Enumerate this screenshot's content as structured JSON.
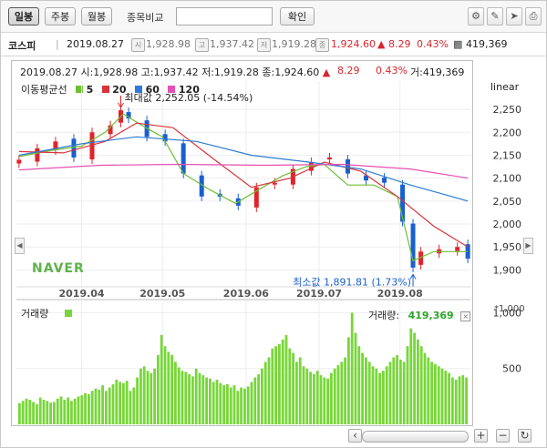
{
  "toolbar": {
    "buttons": [
      "일봉",
      "주봉",
      "월봉"
    ],
    "compare_label": "종목비교",
    "compare_value": "",
    "confirm_label": "확인"
  },
  "info": {
    "index_name": "코스피",
    "date": "2019.08.27",
    "open_tag": "시",
    "open": "1,928.98",
    "high_tag": "고",
    "high": "1,937.42",
    "low_tag": "저",
    "low": "1,919.28",
    "close_tag": "종",
    "close": "1,924.60",
    "change": "▲ 8.29",
    "change_pct": "0.43%",
    "volume": "419,369"
  },
  "chart_header": {
    "line": "2019.08.27 시:1,928.98 고:1,937.42 저:1,919.28 종:1,924.60",
    "arrow": "▲",
    "change": "8.29",
    "pct": "0.43%",
    "volume": "거:419,369"
  },
  "colors": {
    "up": "#e0242b",
    "down": "#1a5fd0",
    "ma5": "#6fbf35",
    "ma20": "#d9343a",
    "ma60": "#2f7ad4",
    "ma120": "#e64fb2",
    "volume": "#78d63a",
    "naver": "#5db34a"
  },
  "chart_data": [
    {
      "type": "line",
      "scale_label": "linear",
      "legend_title": "이동평균선",
      "legend": [
        {
          "label": "5",
          "color": "#6fbf35"
        },
        {
          "label": "20",
          "color": "#d9343a"
        },
        {
          "label": "60",
          "color": "#2f7ad4"
        },
        {
          "label": "120",
          "color": "#e64fb2"
        }
      ],
      "x_ticks": [
        "2019.04",
        "2019.05",
        "2019.06",
        "2019.07",
        "2019.08"
      ],
      "x_tick_dates": [
        "2019-04-01",
        "2019-05-02",
        "2019-06-03",
        "2019-07-01",
        "2019-08-01"
      ],
      "x_range": [
        "2019-03-07",
        "2019-08-28"
      ],
      "y_ticks": [
        1900,
        1950,
        2000,
        2050,
        2100,
        2150,
        2200,
        2250
      ],
      "y_tick_labels": [
        "1,900",
        "1,950",
        "2,000",
        "2,050",
        "2,100",
        "2,150",
        "2,200",
        "2,250"
      ],
      "ylim": [
        1875,
        2272
      ],
      "annotations": {
        "max": {
          "label": "최대값 2,252.05 (-14.54%)",
          "date": "2019-04-16",
          "value": 2252.05
        },
        "min": {
          "label": "최소값 1,891.81 (1.73%)",
          "date": "2019-08-06",
          "value": 1891.81
        }
      },
      "watermark": "NAVER",
      "series": [
        {
          "name": "5",
          "color": "#6fbf35",
          "x": [
            "2019-03-08",
            "2019-03-20",
            "2019-04-01",
            "2019-04-10",
            "2019-04-17",
            "2019-04-25",
            "2019-05-02",
            "2019-05-10",
            "2019-05-20",
            "2019-05-30",
            "2019-06-07",
            "2019-06-17",
            "2019-06-26",
            "2019-07-03",
            "2019-07-12",
            "2019-07-22",
            "2019-07-31",
            "2019-08-06",
            "2019-08-14",
            "2019-08-27"
          ],
          "y": [
            2147,
            2160,
            2170,
            2200,
            2240,
            2212,
            2190,
            2110,
            2075,
            2045,
            2072,
            2105,
            2125,
            2130,
            2085,
            2085,
            2060,
            1920,
            1940,
            1940
          ]
        },
        {
          "name": "20",
          "color": "#d9343a",
          "x": [
            "2019-03-08",
            "2019-03-25",
            "2019-04-10",
            "2019-04-22",
            "2019-05-06",
            "2019-05-22",
            "2019-06-05",
            "2019-06-20",
            "2019-07-03",
            "2019-07-17",
            "2019-07-31",
            "2019-08-14",
            "2019-08-27"
          ],
          "y": [
            2158,
            2155,
            2180,
            2220,
            2210,
            2140,
            2080,
            2100,
            2135,
            2115,
            2060,
            1995,
            1950
          ]
        },
        {
          "name": "60",
          "color": "#2f7ad4",
          "x": [
            "2019-03-08",
            "2019-04-01",
            "2019-04-22",
            "2019-05-15",
            "2019-06-05",
            "2019-06-27",
            "2019-07-17",
            "2019-08-05",
            "2019-08-27"
          ],
          "y": [
            2150,
            2175,
            2190,
            2180,
            2150,
            2135,
            2120,
            2085,
            2050
          ]
        },
        {
          "name": "120",
          "color": "#e64fb2",
          "x": [
            "2019-03-08",
            "2019-04-08",
            "2019-05-08",
            "2019-06-10",
            "2019-07-10",
            "2019-08-05",
            "2019-08-27"
          ],
          "y": [
            2118,
            2128,
            2130,
            2128,
            2130,
            2120,
            2100
          ]
        }
      ],
      "candles_close": {
        "x": [
          "2019-03-08",
          "2019-03-15",
          "2019-03-22",
          "2019-03-29",
          "2019-04-05",
          "2019-04-12",
          "2019-04-16",
          "2019-04-19",
          "2019-04-26",
          "2019-05-03",
          "2019-05-10",
          "2019-05-17",
          "2019-05-24",
          "2019-05-31",
          "2019-06-07",
          "2019-06-14",
          "2019-06-21",
          "2019-06-28",
          "2019-07-05",
          "2019-07-12",
          "2019-07-19",
          "2019-07-26",
          "2019-08-02",
          "2019-08-06",
          "2019-08-09",
          "2019-08-16",
          "2019-08-23",
          "2019-08-27"
        ],
        "y": [
          2140,
          2165,
          2180,
          2145,
          2200,
          2215,
          2248,
          2230,
          2190,
          2180,
          2110,
          2060,
          2060,
          2040,
          2080,
          2090,
          2120,
          2135,
          2145,
          2110,
          2095,
          2090,
          2005,
          1905,
          1940,
          1945,
          1950,
          1924.6
        ]
      }
    },
    {
      "type": "bar",
      "label": "거래량",
      "current_label": "거래량:",
      "current_value": "419,369",
      "unit_label": "*1,000",
      "y_ticks": [
        500,
        1000
      ],
      "y_tick_labels": [
        "500",
        "1,000"
      ],
      "ylim": [
        0,
        1020
      ],
      "values": [
        190,
        210,
        230,
        220,
        200,
        180,
        240,
        220,
        210,
        195,
        200,
        230,
        250,
        220,
        240,
        210,
        230,
        250,
        260,
        280,
        270,
        300,
        320,
        310,
        350,
        300,
        330,
        360,
        400,
        380,
        370,
        390,
        300,
        330,
        420,
        500,
        520,
        480,
        460,
        500,
        620,
        800,
        700,
        650,
        620,
        560,
        510,
        480,
        470,
        450,
        430,
        500,
        460,
        440,
        420,
        410,
        380,
        400,
        370,
        350,
        360,
        330,
        350,
        300,
        330,
        320,
        340,
        380,
        420,
        450,
        500,
        560,
        600,
        680,
        700,
        720,
        760,
        800,
        680,
        640,
        560,
        600,
        520,
        500,
        470,
        450,
        480,
        440,
        420,
        410,
        460,
        500,
        530,
        560,
        600,
        780,
        1000,
        820,
        700,
        640,
        600,
        560,
        520,
        500,
        460,
        480,
        520,
        560,
        600,
        620,
        580,
        560,
        700,
        860,
        820,
        760,
        700,
        640,
        600,
        560,
        540,
        520,
        500,
        480,
        460,
        420,
        400,
        430,
        440,
        420
      ]
    }
  ]
}
